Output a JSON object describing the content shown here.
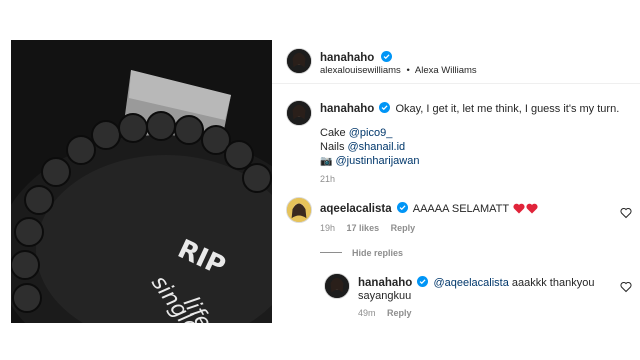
{
  "post_image": {
    "cake_text": [
      "RIP",
      "single",
      "life"
    ]
  },
  "header": {
    "username": "hanahaho",
    "collab_handle": "alexalouisewilliams",
    "separator": "•",
    "location": "Alexa Williams"
  },
  "caption": {
    "username": "hanahaho",
    "text": "Okay, I get it, let me think, I guess it's my turn.",
    "cake_label": "Cake",
    "cake_handle": "@pico9_",
    "nails_label": "Nails",
    "nails_handle": "@shanail.id",
    "photo_handle": "@justinharijawan",
    "camera_emoji": "📷",
    "time": "21h"
  },
  "comments": [
    {
      "username": "aqeelacalista",
      "text": "AAAAA SELAMATT",
      "time": "19h",
      "likes": "17 likes",
      "reply_label": "Reply",
      "avatar_color": "#d6b24c"
    }
  ],
  "hide_replies": "Hide replies",
  "reply": {
    "username": "hanahaho",
    "mention": "@aqeelacalista",
    "text_line1": "aaakkk thankyou",
    "text_line2": "sayangkuu",
    "time": "49m",
    "reply_label": "Reply"
  },
  "colors": {
    "verified": "#0095f6",
    "heart": "#ed4956",
    "link": "#00376b"
  }
}
